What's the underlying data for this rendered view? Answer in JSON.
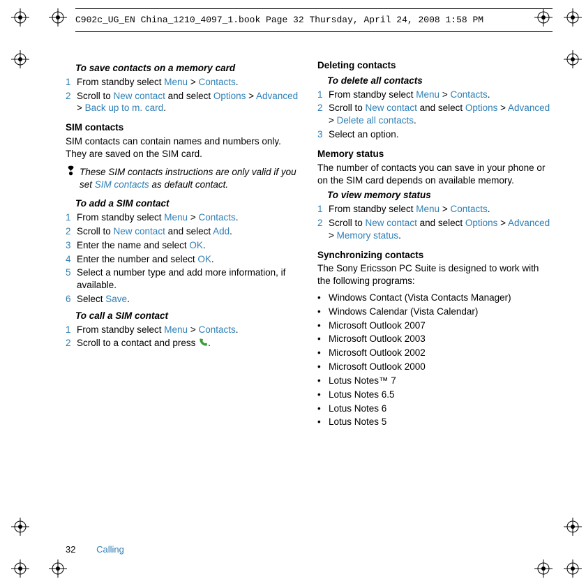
{
  "header": {
    "text": "C902c_UG_EN China_1210_4097_1.book  Page 32  Thursday, April 24, 2008  1:58 PM"
  },
  "left": {
    "task1_title": "To save contacts on a memory card",
    "task1_steps": [
      [
        {
          "t": "From standby select "
        },
        {
          "t": "Menu",
          "hl": true
        },
        {
          "t": " > "
        },
        {
          "t": "Contacts",
          "hl": true
        },
        {
          "t": "."
        }
      ],
      [
        {
          "t": "Scroll to "
        },
        {
          "t": "New contact",
          "hl": true
        },
        {
          "t": " and select "
        },
        {
          "t": "Options",
          "hl": true
        },
        {
          "t": " > "
        },
        {
          "t": "Advanced",
          "hl": true
        },
        {
          "t": " > "
        },
        {
          "t": "Back up to m. card",
          "hl": true
        },
        {
          "t": "."
        }
      ]
    ],
    "sim_title": "SIM contacts",
    "sim_body": "SIM contacts can contain names and numbers only. They are saved on the SIM card.",
    "note_parts": [
      {
        "t": "These SIM contacts instructions are only valid if you set "
      },
      {
        "t": "SIM contacts",
        "hl": true
      },
      {
        "t": " as default contact."
      }
    ],
    "task2_title": "To add a SIM contact",
    "task2_steps": [
      [
        {
          "t": "From standby select "
        },
        {
          "t": "Menu",
          "hl": true
        },
        {
          "t": " > "
        },
        {
          "t": "Contacts",
          "hl": true
        },
        {
          "t": "."
        }
      ],
      [
        {
          "t": "Scroll to "
        },
        {
          "t": "New contact",
          "hl": true
        },
        {
          "t": " and select "
        },
        {
          "t": "Add",
          "hl": true
        },
        {
          "t": "."
        }
      ],
      [
        {
          "t": "Enter the name and select "
        },
        {
          "t": "OK",
          "hl": true
        },
        {
          "t": "."
        }
      ],
      [
        {
          "t": "Enter the number and select "
        },
        {
          "t": "OK",
          "hl": true
        },
        {
          "t": "."
        }
      ],
      [
        {
          "t": "Select a number type and add more information, if available."
        }
      ],
      [
        {
          "t": "Select "
        },
        {
          "t": "Save",
          "hl": true
        },
        {
          "t": "."
        }
      ]
    ],
    "task3_title": "To call a SIM contact",
    "task3_steps": [
      [
        {
          "t": "From standby select "
        },
        {
          "t": "Menu",
          "hl": true
        },
        {
          "t": " > "
        },
        {
          "t": "Contacts",
          "hl": true
        },
        {
          "t": "."
        }
      ],
      [
        {
          "t": "Scroll to a contact and press "
        },
        {
          "t": "__CALL__"
        },
        {
          "t": "."
        }
      ]
    ]
  },
  "right": {
    "del_title": "Deleting contacts",
    "task4_title": "To delete all contacts",
    "task4_steps": [
      [
        {
          "t": "From standby select "
        },
        {
          "t": "Menu",
          "hl": true
        },
        {
          "t": " > "
        },
        {
          "t": "Contacts",
          "hl": true
        },
        {
          "t": "."
        }
      ],
      [
        {
          "t": "Scroll to "
        },
        {
          "t": "New contact",
          "hl": true
        },
        {
          "t": " and select "
        },
        {
          "t": "Options",
          "hl": true
        },
        {
          "t": " > "
        },
        {
          "t": "Advanced",
          "hl": true
        },
        {
          "t": " > "
        },
        {
          "t": "Delete all contacts",
          "hl": true
        },
        {
          "t": "."
        }
      ],
      [
        {
          "t": "Select an option."
        }
      ]
    ],
    "mem_title": "Memory status",
    "mem_body": "The number of contacts you can save in your phone or on the SIM card depends on available memory.",
    "task5_title": "To view memory status",
    "task5_steps": [
      [
        {
          "t": "From standby select "
        },
        {
          "t": "Menu",
          "hl": true
        },
        {
          "t": " > "
        },
        {
          "t": "Contacts",
          "hl": true
        },
        {
          "t": "."
        }
      ],
      [
        {
          "t": "Scroll to "
        },
        {
          "t": "New contact",
          "hl": true
        },
        {
          "t": " and select "
        },
        {
          "t": "Options",
          "hl": true
        },
        {
          "t": " > "
        },
        {
          "t": "Advanced",
          "hl": true
        },
        {
          "t": " > "
        },
        {
          "t": "Memory status",
          "hl": true
        },
        {
          "t": "."
        }
      ]
    ],
    "sync_title": "Synchronizing contacts",
    "sync_body": "The Sony Ericsson PC Suite is designed to work with the following programs:",
    "programs": [
      "Windows Contact (Vista Contacts Manager)",
      "Windows Calendar (Vista Calendar)",
      "Microsoft Outlook 2007",
      "Microsoft Outlook 2003",
      "Microsoft Outlook 2002",
      "Microsoft Outlook 2000",
      "Lotus Notes™ 7",
      "Lotus Notes 6.5",
      "Lotus Notes 6",
      "Lotus Notes 5"
    ]
  },
  "footer": {
    "page": "32",
    "section": "Calling"
  }
}
